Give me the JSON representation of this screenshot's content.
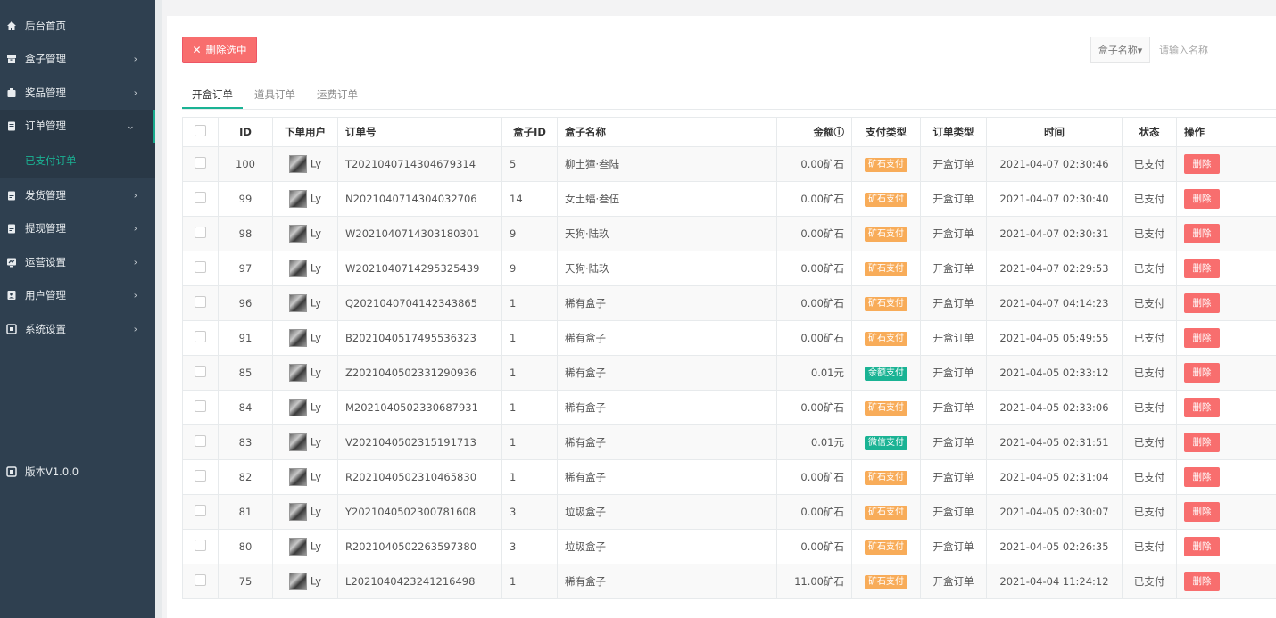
{
  "colors": {
    "sidebar_bg": "#2f4050",
    "accent": "#1ab394",
    "danger": "#f86e6e",
    "ore": "#f8ac59",
    "balance": "#1ab394",
    "wechat": "#1ab394"
  },
  "sidebar": {
    "items": [
      {
        "label": "后台首页",
        "icon": "home-icon",
        "arrow": ""
      },
      {
        "label": "盒子管理",
        "icon": "box-icon",
        "arrow": "›"
      },
      {
        "label": "奖品管理",
        "icon": "gift-icon",
        "arrow": "›"
      },
      {
        "label": "订单管理",
        "icon": "clipboard-icon",
        "arrow": "⌄"
      },
      {
        "label": "发货管理",
        "icon": "clipboard-icon",
        "arrow": "›"
      },
      {
        "label": "提现管理",
        "icon": "clipboard-icon",
        "arrow": "›"
      },
      {
        "label": "运营设置",
        "icon": "operation-icon",
        "arrow": "›"
      },
      {
        "label": "用户管理",
        "icon": "user-icon",
        "arrow": "›"
      },
      {
        "label": "系统设置",
        "icon": "settings-icon",
        "arrow": "›"
      }
    ],
    "sub_item": "已支付订单",
    "version": "版本V1.0.0"
  },
  "toolbar": {
    "delete_label": "删除选中",
    "search_select": "盒子名称▾",
    "search_placeholder": "请输入名称"
  },
  "tabs": [
    "开盒订单",
    "道具订单",
    "运费订单"
  ],
  "table": {
    "headers": [
      "",
      "ID",
      "下单用户",
      "订单号",
      "盒子ID",
      "盒子名称",
      "金额ⓘ",
      "支付类型",
      "订单类型",
      "时间",
      "状态",
      "操作"
    ],
    "delete_label": "删除",
    "rows": [
      {
        "id": "100",
        "user": "Ly",
        "order": "T2021040714304679314",
        "box_id": "5",
        "box_name": "柳土獐·叁陆",
        "amount": "0.00矿石",
        "pay": "矿石支付",
        "pay_kind": "ore",
        "type": "开盒订单",
        "time": "2021-04-07 02:30:46",
        "status": "已支付"
      },
      {
        "id": "99",
        "user": "Ly",
        "order": "N2021040714304032706",
        "box_id": "14",
        "box_name": "女土蝠·叁伍",
        "amount": "0.00矿石",
        "pay": "矿石支付",
        "pay_kind": "ore",
        "type": "开盒订单",
        "time": "2021-04-07 02:30:40",
        "status": "已支付"
      },
      {
        "id": "98",
        "user": "Ly",
        "order": "W2021040714303180301",
        "box_id": "9",
        "box_name": "天狗·陆玖",
        "amount": "0.00矿石",
        "pay": "矿石支付",
        "pay_kind": "ore",
        "type": "开盒订单",
        "time": "2021-04-07 02:30:31",
        "status": "已支付"
      },
      {
        "id": "97",
        "user": "Ly",
        "order": "W2021040714295325439",
        "box_id": "9",
        "box_name": "天狗·陆玖",
        "amount": "0.00矿石",
        "pay": "矿石支付",
        "pay_kind": "ore",
        "type": "开盒订单",
        "time": "2021-04-07 02:29:53",
        "status": "已支付"
      },
      {
        "id": "96",
        "user": "Ly",
        "order": "Q2021040704142343865",
        "box_id": "1",
        "box_name": "稀有盒子",
        "amount": "0.00矿石",
        "pay": "矿石支付",
        "pay_kind": "ore",
        "type": "开盒订单",
        "time": "2021-04-07 04:14:23",
        "status": "已支付"
      },
      {
        "id": "91",
        "user": "Ly",
        "order": "B2021040517495536323",
        "box_id": "1",
        "box_name": "稀有盒子",
        "amount": "0.00矿石",
        "pay": "矿石支付",
        "pay_kind": "ore",
        "type": "开盒订单",
        "time": "2021-04-05 05:49:55",
        "status": "已支付"
      },
      {
        "id": "85",
        "user": "Ly",
        "order": "Z2021040502331290936",
        "box_id": "1",
        "box_name": "稀有盒子",
        "amount": "0.01元",
        "pay": "余额支付",
        "pay_kind": "balance",
        "type": "开盒订单",
        "time": "2021-04-05 02:33:12",
        "status": "已支付"
      },
      {
        "id": "84",
        "user": "Ly",
        "order": "M2021040502330687931",
        "box_id": "1",
        "box_name": "稀有盒子",
        "amount": "0.00矿石",
        "pay": "矿石支付",
        "pay_kind": "ore",
        "type": "开盒订单",
        "time": "2021-04-05 02:33:06",
        "status": "已支付"
      },
      {
        "id": "83",
        "user": "Ly",
        "order": "V2021040502315191713",
        "box_id": "1",
        "box_name": "稀有盒子",
        "amount": "0.01元",
        "pay": "微信支付",
        "pay_kind": "wechat",
        "type": "开盒订单",
        "time": "2021-04-05 02:31:51",
        "status": "已支付"
      },
      {
        "id": "82",
        "user": "Ly",
        "order": "R2021040502310465830",
        "box_id": "1",
        "box_name": "稀有盒子",
        "amount": "0.00矿石",
        "pay": "矿石支付",
        "pay_kind": "ore",
        "type": "开盒订单",
        "time": "2021-04-05 02:31:04",
        "status": "已支付"
      },
      {
        "id": "81",
        "user": "Ly",
        "order": "Y2021040502300781608",
        "box_id": "3",
        "box_name": "垃圾盒子",
        "amount": "0.00矿石",
        "pay": "矿石支付",
        "pay_kind": "ore",
        "type": "开盒订单",
        "time": "2021-04-05 02:30:07",
        "status": "已支付"
      },
      {
        "id": "80",
        "user": "Ly",
        "order": "R2021040502263597380",
        "box_id": "3",
        "box_name": "垃圾盒子",
        "amount": "0.00矿石",
        "pay": "矿石支付",
        "pay_kind": "ore",
        "type": "开盒订单",
        "time": "2021-04-05 02:26:35",
        "status": "已支付"
      },
      {
        "id": "75",
        "user": "Ly",
        "order": "L2021040423241216498",
        "box_id": "1",
        "box_name": "稀有盒子",
        "amount": "11.00矿石",
        "pay": "矿石支付",
        "pay_kind": "ore",
        "type": "开盒订单",
        "time": "2021-04-04 11:24:12",
        "status": "已支付"
      }
    ]
  }
}
